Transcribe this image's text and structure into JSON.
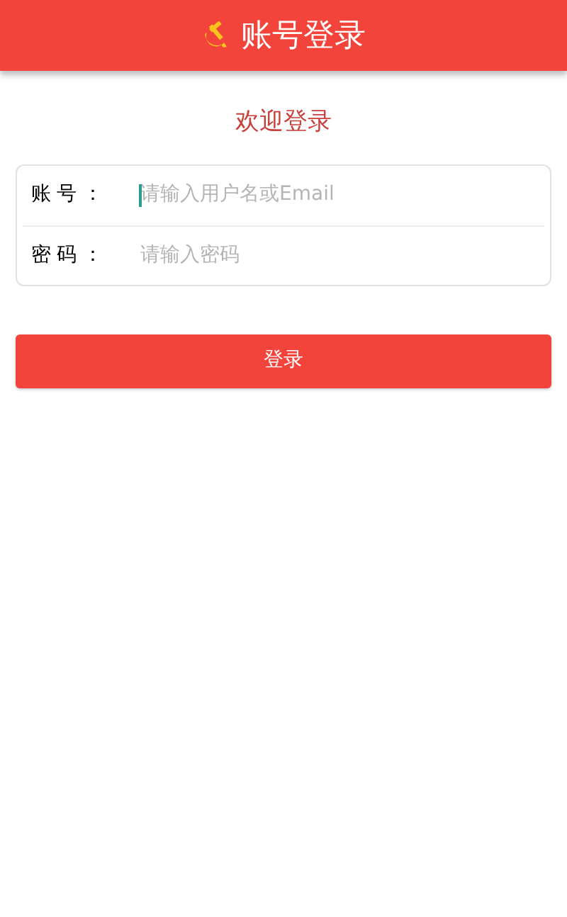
{
  "header": {
    "title": "账号登录"
  },
  "welcome": "欢迎登录",
  "fields": [
    {
      "label": "账号：",
      "placeholder": "请输入用户名或Email",
      "focused": true
    },
    {
      "label": "密码：",
      "placeholder": "请输入密码",
      "focused": false
    }
  ],
  "login_button": "登录"
}
